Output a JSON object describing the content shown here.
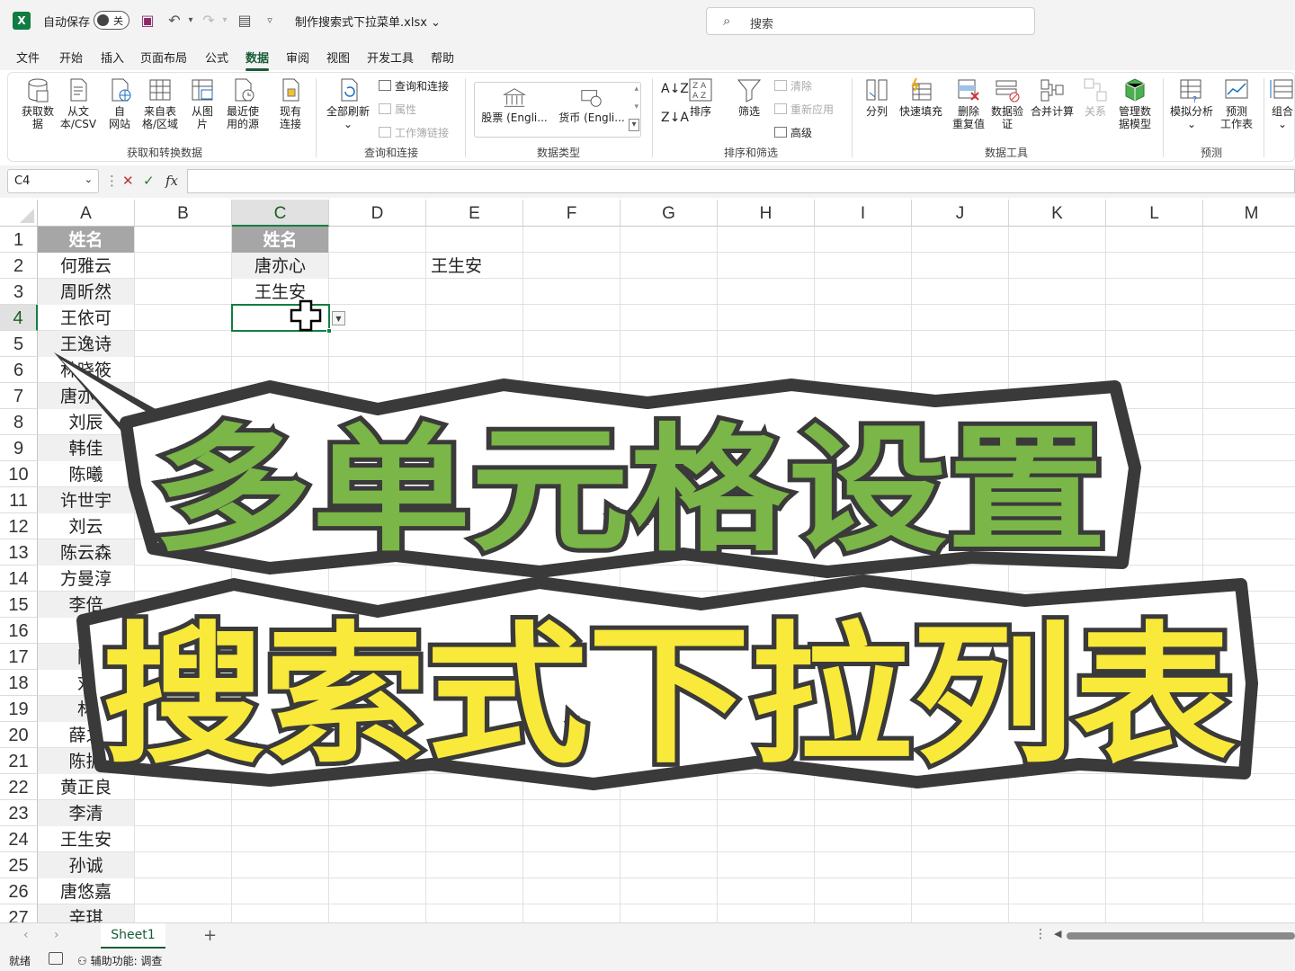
{
  "titlebar": {
    "autosave_label": "自动保存",
    "autosave_state": "关",
    "file_name": "制作搜索式下拉菜单.xlsx",
    "search_placeholder": "搜索"
  },
  "menu": [
    "文件",
    "开始",
    "插入",
    "页面布局",
    "公式",
    "数据",
    "审阅",
    "视图",
    "开发工具",
    "帮助"
  ],
  "menu_active": "数据",
  "ribbon": {
    "get_transform": {
      "label": "获取和转换数据",
      "buttons": [
        "获取数\n据",
        "从文\n本/CSV",
        "自\n网站",
        "来自表\n格/区域",
        "从图\n片",
        "最近使\n用的源",
        "现有\n连接"
      ]
    },
    "queries": {
      "label": "查询和连接",
      "refresh": "全部刷新",
      "items": [
        "查询和连接",
        "属性",
        "工作簿链接"
      ]
    },
    "datatypes": {
      "label": "数据类型",
      "stocks": "股票 (Engli...",
      "currency": "货币 (Engli..."
    },
    "sort_filter": {
      "label": "排序和筛选",
      "sort": "排序",
      "filter": "筛选",
      "clear": "清除",
      "reapply": "重新应用",
      "advanced": "高级"
    },
    "data_tools": {
      "label": "数据工具",
      "buttons": [
        "分列",
        "快速填充",
        "删除\n重复值",
        "数据验\n证",
        "合并计算",
        "关系",
        "管理数\n据模型"
      ]
    },
    "forecast": {
      "label": "预测",
      "buttons": [
        "模拟分析",
        "预测\n工作表"
      ]
    },
    "outline": {
      "button": "组合"
    }
  },
  "formula_bar": {
    "name_box": "C4",
    "formula": ""
  },
  "columns": [
    "A",
    "B",
    "C",
    "D",
    "E",
    "F",
    "G",
    "H",
    "I",
    "J",
    "K",
    "L",
    "M"
  ],
  "selected_column": "C",
  "rows": [
    "1",
    "2",
    "3",
    "4",
    "5",
    "6",
    "7",
    "8",
    "9",
    "10",
    "11",
    "12",
    "13",
    "14",
    "15",
    "16",
    "17",
    "18",
    "19",
    "20",
    "21",
    "22",
    "23",
    "24",
    "25",
    "26",
    "27"
  ],
  "selected_row": "4",
  "column_a": [
    "姓名",
    "何雅云",
    "周昕然",
    "王依可",
    "王逸诗",
    "林晓筱",
    "唐亦心",
    "刘辰",
    "韩佳",
    "陈曦",
    "许世宇",
    "刘云",
    "陈云森",
    "方曼淳",
    "李倍",
    "林",
    "陈",
    "刘",
    "林",
    "薛之",
    "陈振",
    "黄正良",
    "李清",
    "王生安",
    "孙诚",
    "唐悠嘉",
    "辛琪"
  ],
  "column_c": [
    "姓名",
    "唐亦心",
    "王生安"
  ],
  "cell_e2": "王生安",
  "overlay": {
    "line1": "多单元格设置",
    "line2": "搜索式下拉列表"
  },
  "sheets": [
    "Sheet1"
  ],
  "status": {
    "ready": "就绪",
    "accessibility": "辅助功能: 调查"
  },
  "colors": {
    "accent": "#137e43",
    "banner_green": "#7ab648",
    "banner_yellow": "#f9e93a",
    "outline_dark": "#3a3a3a"
  }
}
